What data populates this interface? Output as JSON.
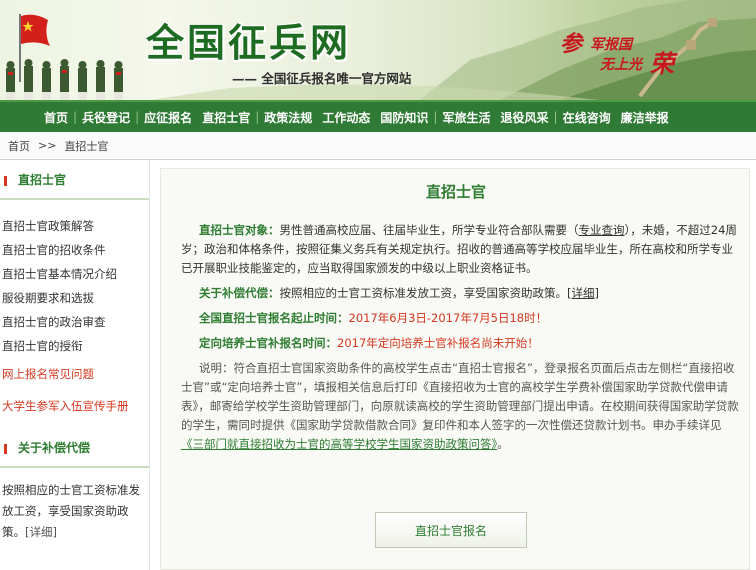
{
  "header": {
    "site_title": "全国征兵网",
    "site_subtitle": "—— 全国征兵报名唯一官方网站",
    "slogan": {
      "c1": "参",
      "c2": "军报国",
      "c3": "无上光",
      "c4": "荣"
    }
  },
  "nav": {
    "items": [
      "首页",
      "兵役登记",
      "应征报名",
      "直招士官",
      "政策法规",
      "工作动态",
      "国防知识",
      "军旅生活",
      "退役风采",
      "在线咨询",
      "廉洁举报"
    ]
  },
  "breadcrumb": {
    "home": "首页",
    "separator": ">>",
    "current": "直招士官"
  },
  "sidebar": {
    "section1_title": "直招士官",
    "items": [
      "直招士官政策解答",
      "直招士官的招收条件",
      "直招士官基本情况介绍",
      "服役期要求和选拔",
      "直招士官的政治审查",
      "直招士官的授衔"
    ],
    "red_items": [
      "网上报名常见问题",
      "大学生参军入伍宣传手册"
    ],
    "section2_title": "关于补偿代偿",
    "section2_text": "按照相应的士官工资标准发放工资，享受国家资助政策。",
    "section2_more": "[详细]"
  },
  "main": {
    "title": "直招士官",
    "target_label": "直招士官对象：",
    "target_text_a": "男性普通高校应届、往届毕业生，所学专业符合部队需要（",
    "target_link": "专业查询",
    "target_text_b": "），未婚，不超过24周岁；政治和体格条件，按照征集义务兵有关规定执行。招收的普通高等学校应届毕业生，所在高校和所学专业已开展职业技能鉴定的，应当取得国家颁发的中级以上职业资格证书。",
    "comp_label": "关于补偿代偿：",
    "comp_text": "按照相应的士官工资标准发放工资，享受国家资助政策。",
    "comp_more": "[详细]",
    "reg_time_label": "全国直招士官报名起止时间：",
    "reg_time_value": "2017年6月3日-2017年7月5日18时！",
    "directed_label": "定向培养士官补报名时间：",
    "directed_value": "2017年定向培养士官补报名尚未开始！",
    "note_text": "说明：符合直招士官国家资助条件的高校学生点击“直招士官报名”，登录报名页面后点击左侧栏“直接招收士官”或“定向培养士官”，填报相关信息后打印《直接招收为士官的高校学生学费补偿国家助学贷款代偿申请表》，邮寄给学校学生资助管理部门，向原就读高校的学生资助管理部门提出申请。在校期间获得国家助学贷款的学生，需同时提供《国家助学贷款借款合同》复印件和本人签字的一次性偿还贷款计划书。申办手续详见",
    "note_link": "《三部门就直接招收为士官的高等学校学生国家资助政策问答》",
    "note_end": "。",
    "apply_button": "直招士官报名"
  }
}
